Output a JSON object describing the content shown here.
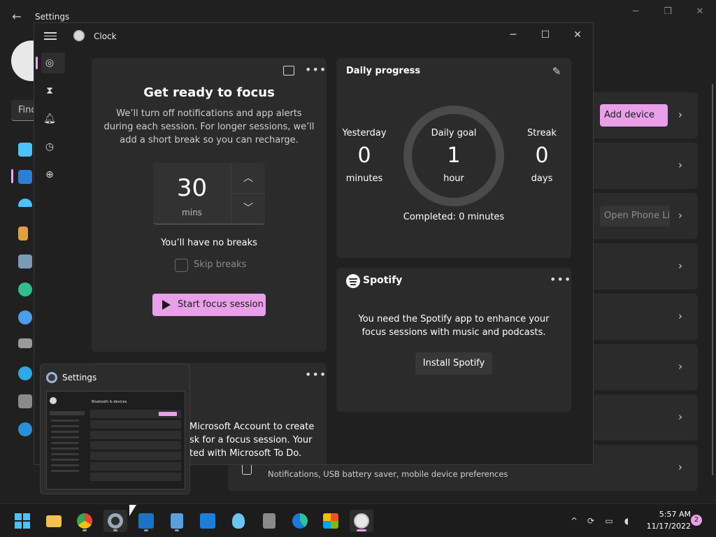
{
  "settings": {
    "title": "Settings",
    "back_icon": "back-arrow-icon",
    "search_placeholder": "Find",
    "add_device_label": "Add device",
    "phone_link_label": "Open Phone Link",
    "mobile_row_description": "Notifications, USB battery saver, mobile device preferences"
  },
  "clock": {
    "title": "Clock",
    "nav": [
      "focus-sessions-icon",
      "timer-icon",
      "alarm-icon",
      "stopwatch-icon",
      "world-clock-icon"
    ],
    "focus_card": {
      "heading": "Get ready to focus",
      "description": "We’ll turn off notifications and app alerts during each session. For longer sessions, we’ll add a short break so you can recharge.",
      "timer_value": "30",
      "timer_unit": "mins",
      "breaks_text": "You’ll have no breaks",
      "skip_breaks_label": "Skip breaks",
      "start_button_label": "Start focus session"
    },
    "todo_card": {
      "text": "Microsoft Account to create sk for a focus session. Your ted with Microsoft To Do."
    },
    "daily_progress": {
      "title": "Daily progress",
      "yesterday_label": "Yesterday",
      "yesterday_value": "0",
      "yesterday_unit": "minutes",
      "goal_label": "Daily goal",
      "goal_value": "1",
      "goal_unit": "hour",
      "streak_label": "Streak",
      "streak_value": "0",
      "streak_unit": "days",
      "completed_text": "Completed: 0 minutes"
    },
    "spotify": {
      "brand": "Spotify",
      "description": "You need the Spotify app to enhance your focus sessions with music and podcasts.",
      "install_label": "Install Spotify"
    }
  },
  "preview": {
    "title": "Settings",
    "thumb_title": "Bluetooth & devices"
  },
  "taskbar": {
    "apps": [
      "start-icon",
      "file-explorer-icon",
      "chrome-icon",
      "settings-icon",
      "mail-icon",
      "notepad-icon",
      "calendar-icon",
      "tips-icon",
      "calculator-icon",
      "edge-icon",
      "store-icon",
      "clock-icon"
    ],
    "time": "5:57 AM",
    "date": "11/17/2022",
    "notification_count": "2"
  },
  "colors": {
    "accent": "#e9a0e9",
    "background": "#202020",
    "card": "#2b2b2b"
  }
}
